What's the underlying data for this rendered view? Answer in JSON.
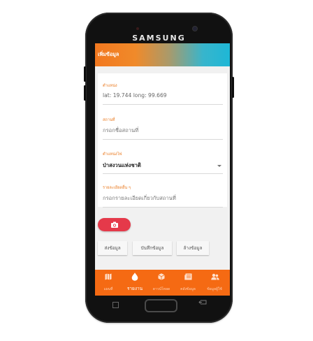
{
  "device": {
    "brand": "SAMSUNG"
  },
  "appbar": {
    "title": "เพิ่มข้อมูล"
  },
  "form": {
    "position": {
      "label": "ตำแหน่ง",
      "value": "lat: 19.744 long: 99.669"
    },
    "place": {
      "label": "สถานที่",
      "placeholder": "กรอกชื่อสถานที่"
    },
    "fire_location": {
      "label": "ตำแหน่งไฟ",
      "selected": "ป่าสงวนแห่งชาติ"
    },
    "details": {
      "label": "รายละเอียดอื่น ๆ",
      "placeholder": "กรอกรายละเอียดเกี่ยวกับสถานที่"
    }
  },
  "actions": {
    "send": "ส่งข้อมูล",
    "save": "บันทึกข้อมูล",
    "clear": "ล้างข้อมูล"
  },
  "bottom_nav": [
    {
      "label": "แผนที่",
      "icon": "map-icon"
    },
    {
      "label": "รายงาน",
      "icon": "fire-drop-icon",
      "active": true
    },
    {
      "label": "ดาวน์โหลด",
      "icon": "box-icon"
    },
    {
      "label": "คลังข้อมูล",
      "icon": "newspaper-icon"
    },
    {
      "label": "ข้อมูลผู้ใช้",
      "icon": "users-icon"
    }
  ],
  "colors": {
    "accent": "#f56a13",
    "label": "#ea7b22",
    "camera": "#e5394a",
    "gradient_end": "#1eb7d6"
  }
}
